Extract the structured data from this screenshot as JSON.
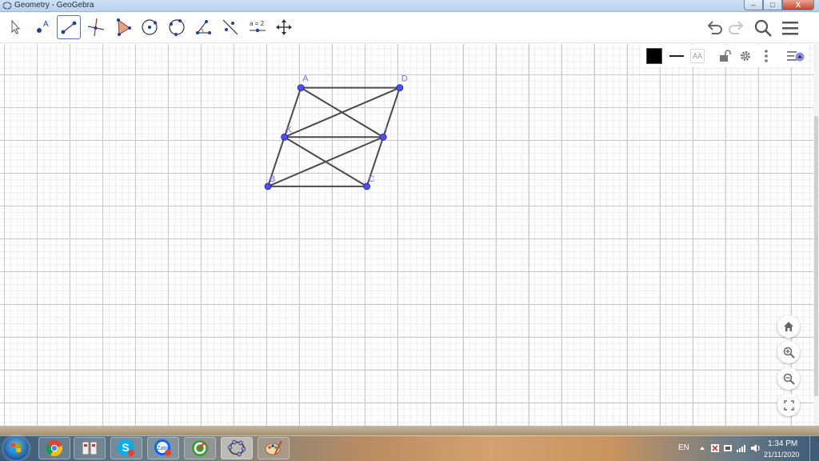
{
  "window": {
    "title": "Geometry - GeoGebra",
    "controls": {
      "minimize": "–",
      "maximize": "□",
      "close": "X"
    }
  },
  "toolbar": {
    "tools": [
      {
        "name": "move-tool",
        "icon": "arrow-cursor-icon"
      },
      {
        "name": "point-tool",
        "icon": "point-icon",
        "label": "A"
      },
      {
        "name": "segment-tool",
        "icon": "segment-icon",
        "active": true
      },
      {
        "name": "perpendicular-line-tool",
        "icon": "perpendicular-icon"
      },
      {
        "name": "polygon-tool",
        "icon": "triangle-icon"
      },
      {
        "name": "circle-center-point-tool",
        "icon": "circle-icon"
      },
      {
        "name": "circle-three-points-tool",
        "icon": "circle-three-points-icon"
      },
      {
        "name": "angle-tool",
        "icon": "angle-icon"
      },
      {
        "name": "reflect-tool",
        "icon": "reflect-icon"
      },
      {
        "name": "slider-tool",
        "icon": "slider-icon",
        "label": "a = 2"
      },
      {
        "name": "move-graphics-view-tool",
        "icon": "move-arrows-icon"
      }
    ],
    "right": [
      "undo-icon",
      "redo-icon",
      "search-icon",
      "menu-icon"
    ]
  },
  "stylebar": {
    "color": "#000000",
    "text_size_label": "AA",
    "items": [
      "color-swatch",
      "line-style",
      "text-size",
      "lock-icon",
      "gear-icon",
      "more-icon",
      "toggle-stylebar-icon"
    ]
  },
  "construction": {
    "points": [
      {
        "label": "A",
        "x": 1,
        "y": 4
      },
      {
        "label": "D",
        "x": 4,
        "y": 4
      },
      {
        "label": "K",
        "x": 0.5,
        "y": 2.5
      },
      {
        "label": "I",
        "x": 3.5,
        "y": 2.5
      },
      {
        "label": "B",
        "x": 0,
        "y": 1
      },
      {
        "label": "C",
        "x": 3,
        "y": 1
      }
    ],
    "segments": [
      [
        "A",
        "D"
      ],
      [
        "A",
        "B"
      ],
      [
        "D",
        "C"
      ],
      [
        "B",
        "C"
      ],
      [
        "K",
        "I"
      ],
      [
        "A",
        "I"
      ],
      [
        "D",
        "K"
      ],
      [
        "K",
        "C"
      ],
      [
        "B",
        "I"
      ]
    ],
    "point_color": "#4d4dff",
    "segment_color": "#4a4a4a",
    "label_color": "#6e6ee6"
  },
  "zoom_controls": [
    "home-icon",
    "zoom-in-icon",
    "zoom-out-icon",
    "fullscreen-icon"
  ],
  "taskbar": {
    "items": [
      "chrome-icon",
      "calculator-icon",
      "skype-icon",
      "zalo-icon",
      "cleaner-icon",
      "geogebra-icon",
      "paint-icon"
    ],
    "zalo_label": "Zalo",
    "language": "EN",
    "time": "1:34 PM",
    "date": "21/11/2020"
  }
}
